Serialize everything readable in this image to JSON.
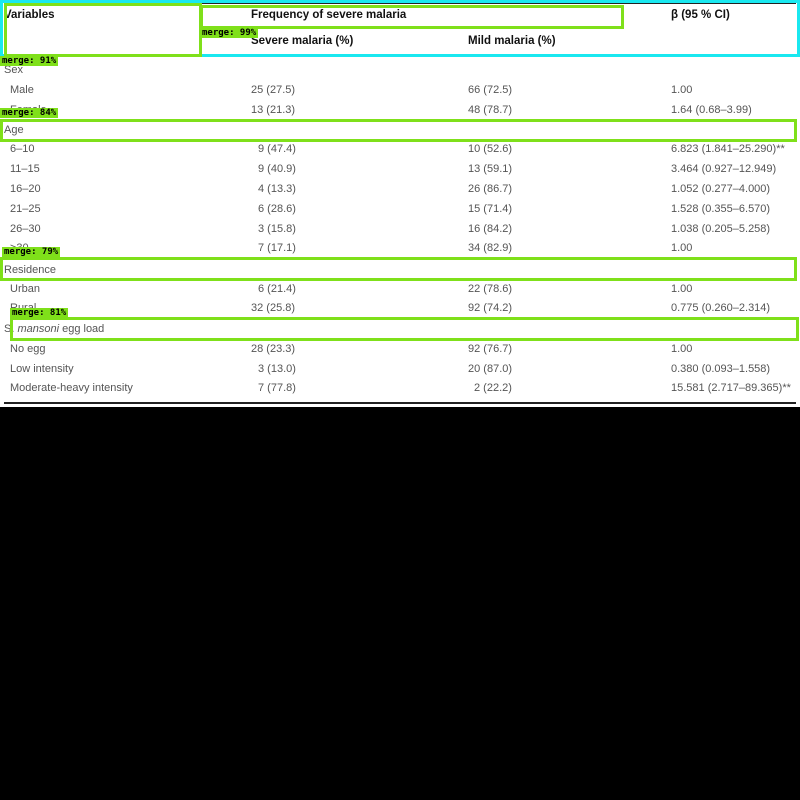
{
  "table": {
    "headers": {
      "variables": "Variables",
      "frequency_group": "Frequency of severe malaria",
      "severe": "Severe malaria (%)",
      "mild": "Mild malaria (%)",
      "beta": "β (95 % CI)"
    },
    "sections": [
      {
        "title": "Sex",
        "rows": [
          {
            "label": "Male",
            "severe": "25 (27.5)",
            "mild": "66 (72.5)",
            "beta": "1.00"
          },
          {
            "label": "Female",
            "severe": "13 (21.3)",
            "mild": "48 (78.7)",
            "beta": "1.64 (0.68–3.99)"
          }
        ]
      },
      {
        "title": "Age",
        "rows": [
          {
            "label": "6–10",
            "severe": "9 (47.4)",
            "mild": "10 (52.6)",
            "beta": "6.823 (1.841–25.290)**"
          },
          {
            "label": "11–15",
            "severe": "9 (40.9)",
            "mild": "13 (59.1)",
            "beta": "3.464 (0.927–12.949)"
          },
          {
            "label": "16–20",
            "severe": "4 (13.3)",
            "mild": "26 (86.7)",
            "beta": "1.052 (0.277–4.000)"
          },
          {
            "label": "21–25",
            "severe": "6 (28.6)",
            "mild": "15 (71.4)",
            "beta": "1.528 (0.355–6.570)"
          },
          {
            "label": "26–30",
            "severe": "3 (15.8)",
            "mild": "16 (84.2)",
            "beta": "1.038 (0.205–5.258)"
          },
          {
            "label": ">30",
            "severe": "7 (17.1)",
            "mild": "34 (82.9)",
            "beta": "1.00"
          }
        ]
      },
      {
        "title": "Residence",
        "rows": [
          {
            "label": "Urban",
            "severe": "6 (21.4)",
            "mild": "22 (78.6)",
            "beta": "1.00"
          },
          {
            "label": "Rural",
            "severe": "32 (25.8)",
            "mild": "92 (74.2)",
            "beta": "0.775 (0.260–2.314)"
          }
        ]
      },
      {
        "title_prefix": "S. ",
        "title_italic": "mansoni",
        "title": " egg load",
        "rows": [
          {
            "label": "No egg",
            "severe": "28 (23.3)",
            "mild": "92 (76.7)",
            "beta": "1.00"
          },
          {
            "label": "Low intensity",
            "severe": "3 (13.0)",
            "mild": "20 (87.0)",
            "beta": "0.380 (0.093–1.558)"
          },
          {
            "label": "Moderate-heavy intensity",
            "severe": "7 (77.8)",
            "mild": "2 (22.2)",
            "beta": "15.581 (2.717–89.365)**"
          }
        ]
      }
    ]
  },
  "overlays": {
    "tags": [
      "merge: 91%",
      "merge: 99%",
      "merge: 84%",
      "merge: 79%",
      "merge: 81%"
    ]
  },
  "colors": {
    "box_green": "#7fe01a",
    "box_cyan": "#19e8f0",
    "background": "#000000",
    "document": "#ffffff"
  }
}
